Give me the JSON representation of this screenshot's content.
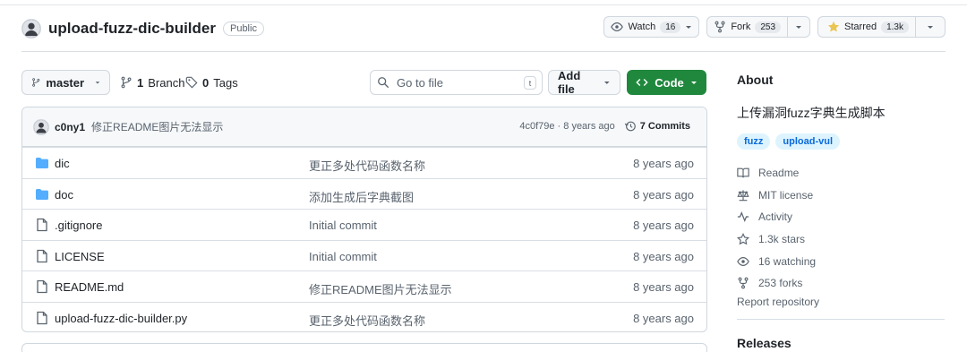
{
  "repo": {
    "name": "upload-fuzz-dic-builder",
    "visibility": "Public"
  },
  "header_actions": {
    "watch_label": "Watch",
    "watch_count": "16",
    "fork_label": "Fork",
    "fork_count": "253",
    "star_label": "Starred",
    "star_count": "1.3k"
  },
  "toolbar": {
    "branch": "master",
    "branch_count": "1",
    "branch_label": "Branch",
    "tag_count": "0",
    "tag_label": "Tags",
    "search_placeholder": "Go to file",
    "search_shortcut": "t",
    "add_file_label": "Add file",
    "code_label": "Code"
  },
  "latest_commit": {
    "author": "c0ny1",
    "message": "修正README图片无法显示",
    "hash": "4c0f79e",
    "age": "· 8 years ago",
    "commits_label": "7 Commits"
  },
  "files": [
    {
      "type": "folder",
      "name": "dic",
      "message": "更正多处代码函数名称",
      "age": "8 years ago"
    },
    {
      "type": "folder",
      "name": "doc",
      "message": "添加生成后字典截图",
      "age": "8 years ago"
    },
    {
      "type": "file",
      "name": ".gitignore",
      "message": "Initial commit",
      "age": "8 years ago"
    },
    {
      "type": "file",
      "name": "LICENSE",
      "message": "Initial commit",
      "age": "8 years ago"
    },
    {
      "type": "file",
      "name": "README.md",
      "message": "修正README图片无法显示",
      "age": "8 years ago"
    },
    {
      "type": "file",
      "name": "upload-fuzz-dic-builder.py",
      "message": "更正多处代码函数名称",
      "age": "8 years ago"
    }
  ],
  "about": {
    "title": "About",
    "description": "上传漏洞fuzz字典生成脚本",
    "topics": [
      "fuzz",
      "upload-vul"
    ],
    "readme": "Readme",
    "license": "MIT license",
    "activity": "Activity",
    "stars": "1.3k stars",
    "watching": "16 watching",
    "forks": "253 forks",
    "report": "Report repository"
  },
  "releases_title": "Releases",
  "colors": {
    "accent_green": "#1f883d",
    "link_blue": "#0969da",
    "folder_blue": "#54aeff",
    "star_yellow": "#eac54f"
  }
}
